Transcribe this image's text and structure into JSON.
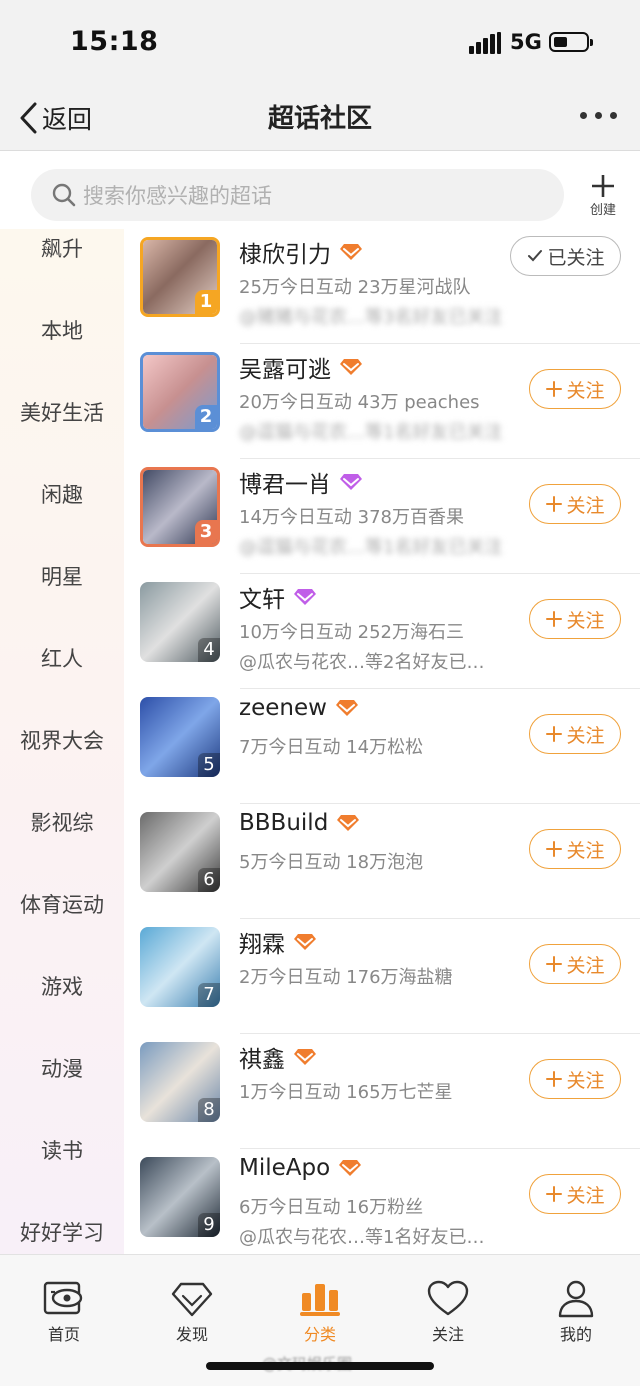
{
  "status_bar": {
    "time": "15:18",
    "network": "5G"
  },
  "nav": {
    "back_label": "返回",
    "title": "超话社区"
  },
  "search": {
    "placeholder": "搜索你感兴趣的超话"
  },
  "create": {
    "label": "创建"
  },
  "sidebar": {
    "items": [
      "飙升",
      "本地",
      "美好生活",
      "闲趣",
      "明星",
      "红人",
      "视界大会",
      "影视综",
      "体育运动",
      "游戏",
      "动漫",
      "读书",
      "好好学习"
    ]
  },
  "topics": [
    {
      "rank": "1",
      "name": "棣欣引力",
      "gem": "orange",
      "stats": "25万今日互动 23万星河战队",
      "friends": "@猪猪与花农…等3名好友已关注",
      "friends_blurred": true,
      "button": "已关注",
      "followed": true
    },
    {
      "rank": "2",
      "name": "吴露可逃",
      "gem": "orange",
      "stats": "20万今日互动 43万 peaches",
      "friends": "@逗猫与花农…等1名好友已关注",
      "friends_blurred": true,
      "button": "关注",
      "followed": false
    },
    {
      "rank": "3",
      "name": "博君一肖",
      "gem": "purple",
      "stats": "14万今日互动 378万百香果",
      "friends": "@逗猫与花农…等1名好友已关注",
      "friends_blurred": true,
      "button": "关注",
      "followed": false
    },
    {
      "rank": "4",
      "name": "文轩",
      "gem": "purple",
      "stats": "10万今日互动 252万海石三",
      "friends": "@瓜农与花农…等2名好友已…",
      "friends_blurred": false,
      "button": "关注",
      "followed": false
    },
    {
      "rank": "5",
      "name": "zeenew",
      "gem": "orange",
      "stats": "7万今日互动 14万松松",
      "friends": "",
      "friends_blurred": false,
      "button": "关注",
      "followed": false
    },
    {
      "rank": "6",
      "name": "BBBuild",
      "gem": "orange",
      "stats": "5万今日互动 18万泡泡",
      "friends": "",
      "friends_blurred": false,
      "button": "关注",
      "followed": false
    },
    {
      "rank": "7",
      "name": "翔霖",
      "gem": "orange",
      "stats": "2万今日互动 176万海盐糖",
      "friends": "",
      "friends_blurred": false,
      "button": "关注",
      "followed": false
    },
    {
      "rank": "8",
      "name": "祺鑫",
      "gem": "orange",
      "stats": "1万今日互动 165万七芒星",
      "friends": "",
      "friends_blurred": false,
      "button": "关注",
      "followed": false
    },
    {
      "rank": "9",
      "name": "MileApo",
      "gem": "orange",
      "stats": "6万今日互动 16万粉丝",
      "friends": "@瓜农与花农…等1名好友已…",
      "friends_blurred": false,
      "button": "关注",
      "followed": false
    }
  ],
  "tabs": [
    {
      "label": "首页",
      "icon": "home-eye-icon",
      "active": false
    },
    {
      "label": "发现",
      "icon": "diamond-icon",
      "active": false
    },
    {
      "label": "分类",
      "icon": "bar-category-icon",
      "active": true
    },
    {
      "label": "关注",
      "icon": "heart-icon",
      "active": false
    },
    {
      "label": "我的",
      "icon": "person-icon",
      "active": false
    }
  ],
  "watermark": "@文玛娱乐圈",
  "colors": {
    "accent": "#f08a24",
    "follow_border": "#f0a23c",
    "gem_orange": "#f07d2e",
    "gem_purple": "#c05ee8",
    "rank_gold": "#f5a623",
    "rank_blue": "#5b8fd6",
    "rank_red": "#e8764f"
  }
}
